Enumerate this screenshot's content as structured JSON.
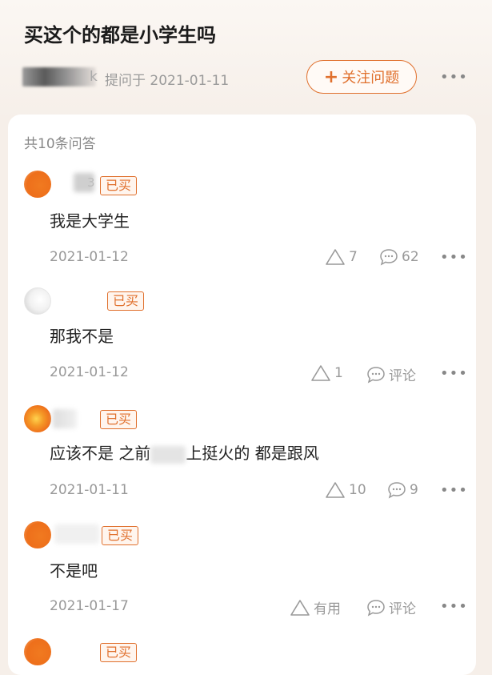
{
  "question": {
    "title": "买这个的都是小学生吗",
    "asker_suffix": "k",
    "asked_at": "提问于 2021-01-11",
    "follow_label": "关注问题",
    "follow_icon": "plus-icon",
    "more": "•••"
  },
  "answers_count": "共10条问答",
  "bought_badge": "已买",
  "answers": [
    {
      "text": "我是大学生",
      "date": "2021-01-12",
      "likes": "7",
      "comments": "62",
      "name_suffix": "3"
    },
    {
      "text": "那我不是",
      "date": "2021-01-12",
      "likes": "1",
      "comments": "评论"
    },
    {
      "text_before": "应该不是 之前",
      "text_after": "上挺火的 都是跟风",
      "date": "2021-01-11",
      "likes": "10",
      "comments": "9"
    },
    {
      "text": "不是吧",
      "date": "2021-01-17",
      "likes": "有用",
      "comments": "评论"
    }
  ],
  "colors": {
    "accent": "#e0702d",
    "muted": "#999999",
    "background": "#f6efe9"
  },
  "icons": {
    "like": "triangle-like-icon",
    "comment": "comment-bubble-icon",
    "more": "more-dots-icon"
  }
}
